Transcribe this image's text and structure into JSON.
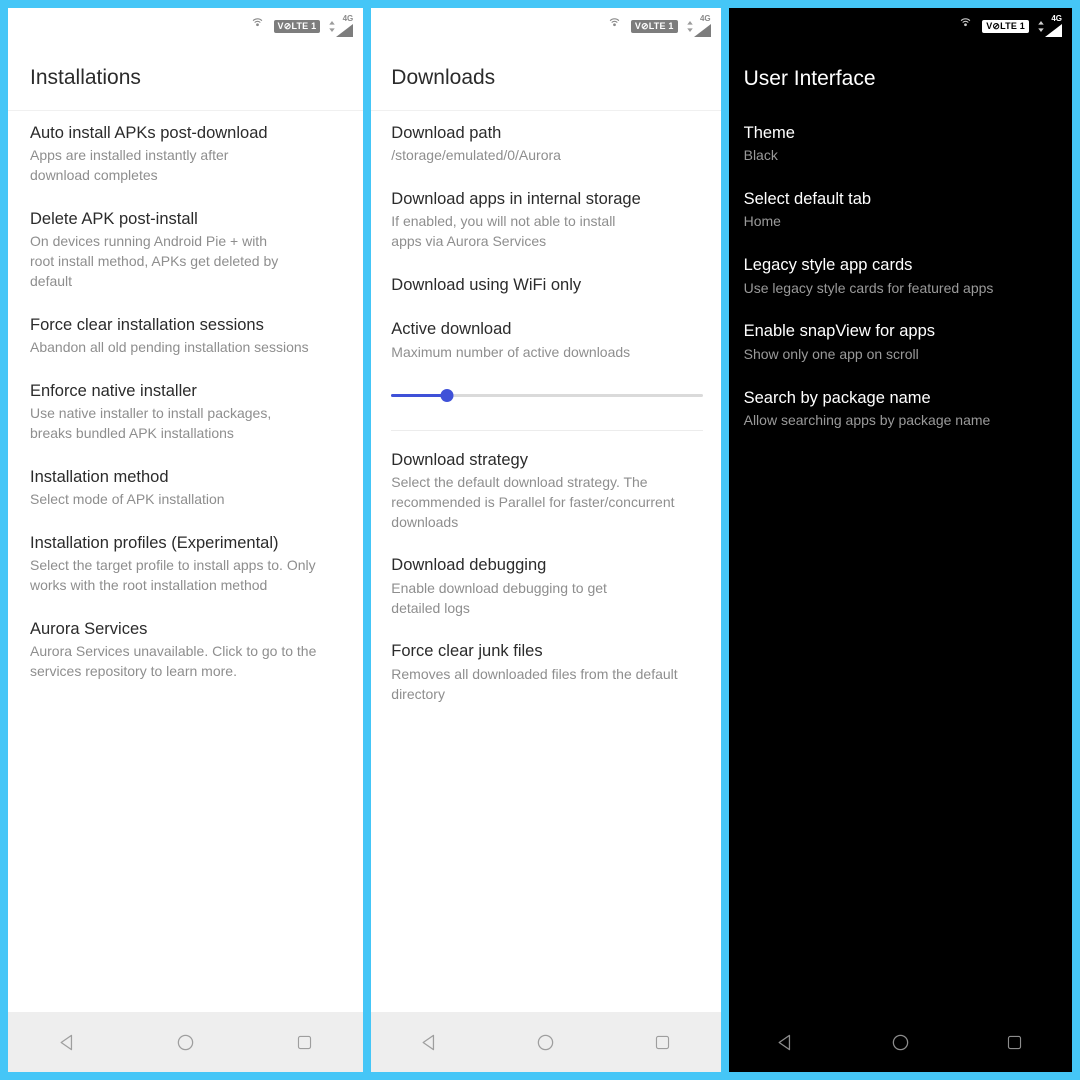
{
  "theme": {
    "collage_border_color": "#45c6f7",
    "light_bg": "#ffffff",
    "dark_bg": "#000000",
    "accent_slider_color": "#3f51d8",
    "title_color_light": "#2b2b2b",
    "subtitle_color_light": "#8e8e8e",
    "title_color_dark": "#ffffff",
    "subtitle_color_dark": "#9a9a9a"
  },
  "status_bar": {
    "cast_icon": "cast-icon",
    "volte_label": "V⊘LTE 1",
    "network_generation": "4G",
    "data_arrows_icon": "data-transfer-arrows-icon",
    "signal_icon": "signal-bars-icon"
  },
  "nav_bar": {
    "back_label": "back-icon",
    "home_label": "home-icon",
    "recents_label": "recents-icon"
  },
  "panels": [
    {
      "id": "installations",
      "header": "Installations",
      "items": [
        {
          "title": "Auto install APKs post-download",
          "subtitle": "Apps are installed instantly after\ndownload completes"
        },
        {
          "title": "Delete APK post-install",
          "subtitle": "On devices running Android Pie + with\nroot install method, APKs get deleted by\ndefault"
        },
        {
          "title": "Force clear installation sessions",
          "subtitle": "Abandon all old pending installation sessions"
        },
        {
          "title": "Enforce native installer",
          "subtitle": "Use native installer to install packages,\nbreaks bundled APK installations"
        },
        {
          "title": "Installation method",
          "subtitle": "Select mode of APK installation"
        },
        {
          "title": "Installation profiles (Experimental)",
          "subtitle": "Select the target profile to install apps to. Only\nworks with the root installation method"
        },
        {
          "title": "Aurora Services",
          "subtitle": "Aurora Services unavailable. Click to go to the\nservices repository to learn more."
        }
      ]
    },
    {
      "id": "downloads",
      "header": "Downloads",
      "items": [
        {
          "title": "Download path",
          "subtitle": "/storage/emulated/0/Aurora"
        },
        {
          "title": "Download apps in internal storage",
          "subtitle": "If enabled, you will not able to install\napps via Aurora Services"
        },
        {
          "title": "Download using WiFi only",
          "subtitle": ""
        },
        {
          "title": "Active download",
          "subtitle": "Maximum number of active downloads",
          "slider": {
            "percent": 18,
            "name": "active-download-slider"
          }
        },
        {
          "title": "Download strategy",
          "subtitle": "Select the default download strategy. The\nrecommended is Parallel for faster/concurrent\ndownloads"
        },
        {
          "title": "Download debugging",
          "subtitle": "Enable download debugging to get\ndetailed logs"
        },
        {
          "title": "Force clear junk files",
          "subtitle": "Removes all downloaded files from the default\ndirectory"
        }
      ]
    },
    {
      "id": "user-interface",
      "header": "User Interface",
      "items": [
        {
          "title": "Theme",
          "subtitle": "Black"
        },
        {
          "title": "Select default tab",
          "subtitle": "Home"
        },
        {
          "title": "Legacy style app cards",
          "subtitle": "Use legacy style cards for featured apps"
        },
        {
          "title": "Enable snapView for apps",
          "subtitle": "Show only one app on scroll"
        },
        {
          "title": "Search by package name",
          "subtitle": "Allow searching apps by package name"
        }
      ]
    }
  ]
}
